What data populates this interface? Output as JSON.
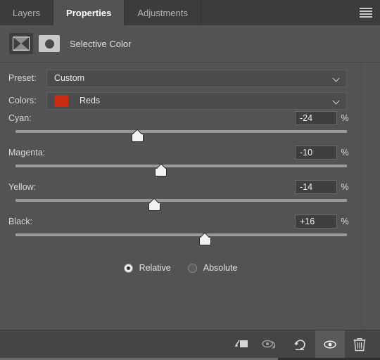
{
  "window": {
    "title": "Properties",
    "menu_icon": "hamburger-menu-icon"
  },
  "tabs": [
    {
      "label": "Layers",
      "active": false
    },
    {
      "label": "Properties",
      "active": true
    },
    {
      "label": "Adjustments",
      "active": false
    }
  ],
  "header": {
    "adjustment_icon": "selective-color-icon",
    "mask_icon": "layer-mask-thumbnail-icon",
    "title": "Selective Color"
  },
  "preset": {
    "label": "Preset:",
    "value": "Custom",
    "chevron": "chevron-down-icon"
  },
  "colors": {
    "label": "Colors:",
    "value": "Reds",
    "swatch_color": "#c72b11",
    "chevron": "chevron-down-icon"
  },
  "sliders": [
    {
      "name": "Cyan:",
      "value": "-24",
      "unit": "%",
      "percent": 38
    },
    {
      "name": "Magenta:",
      "value": "-10",
      "unit": "%",
      "percent": 45
    },
    {
      "name": "Yellow:",
      "value": "-14",
      "unit": "%",
      "percent": 43
    },
    {
      "name": "Black:",
      "value": "+16",
      "unit": "%",
      "percent": 58
    }
  ],
  "method": {
    "options": [
      {
        "label": "Relative",
        "selected": true
      },
      {
        "label": "Absolute",
        "selected": false
      }
    ]
  },
  "footer": {
    "buttons": [
      {
        "name": "clip-to-layer-icon",
        "active": false
      },
      {
        "name": "view-previous-state-icon",
        "active": false
      },
      {
        "name": "reset-icon",
        "active": false
      },
      {
        "name": "toggle-visibility-eye-icon",
        "active": true
      },
      {
        "name": "delete-trash-icon",
        "active": false
      }
    ]
  }
}
